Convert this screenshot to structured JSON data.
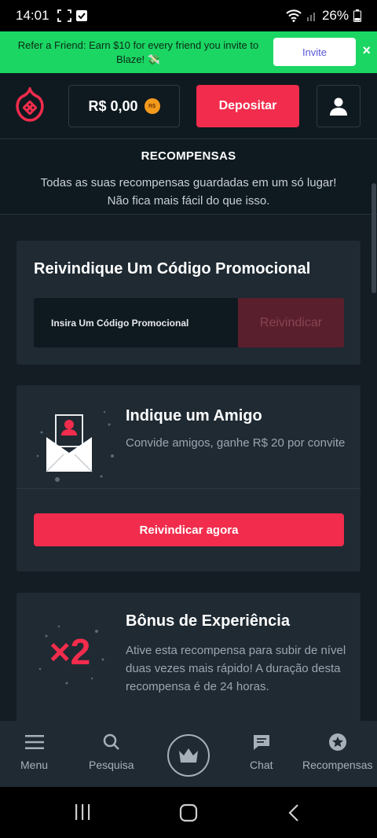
{
  "status_bar": {
    "time": "14:01",
    "battery": "26%"
  },
  "banner": {
    "text": "Refer a Friend: Earn $10 for every friend you invite to Blaze! 💸",
    "invite_label": "Invite",
    "close_glyph": "×"
  },
  "header": {
    "balance": "R$ 0,00",
    "coin_label": "R$",
    "deposit_label": "Depositar"
  },
  "rewards": {
    "title": "RECOMPENSAS",
    "description": "Todas as suas recompensas guardadas em um só lugar! Não fica mais fácil do que isso."
  },
  "promo_card": {
    "title": "Reivindique Um Código Promocional",
    "input_placeholder": "Insira Um Código Promocional",
    "claim_label": "Reivindicar"
  },
  "friend_card": {
    "title": "Indique um Amigo",
    "description": "Convide amigos, ganhe R$ 20 por convite",
    "button_label": "Reivindicar agora"
  },
  "xp_card": {
    "title": "Bônus de Experiência",
    "description": "Ative esta recompensa para subir de nível duas vezes mais rápido! A duração desta recompensa é de 24 horas.",
    "multiplier": "×2"
  },
  "bottom_nav": {
    "items": [
      {
        "label": "Menu",
        "icon": "hamburger-icon"
      },
      {
        "label": "Pesquisa",
        "icon": "search-icon"
      },
      {
        "label": "",
        "icon": "crown-icon"
      },
      {
        "label": "Chat",
        "icon": "chat-icon"
      },
      {
        "label": "Recompensas",
        "icon": "star-icon"
      }
    ]
  },
  "colors": {
    "accent": "#f12c4c",
    "banner_green": "#1bd663",
    "background": "#141c24",
    "card": "#1f2a33"
  }
}
